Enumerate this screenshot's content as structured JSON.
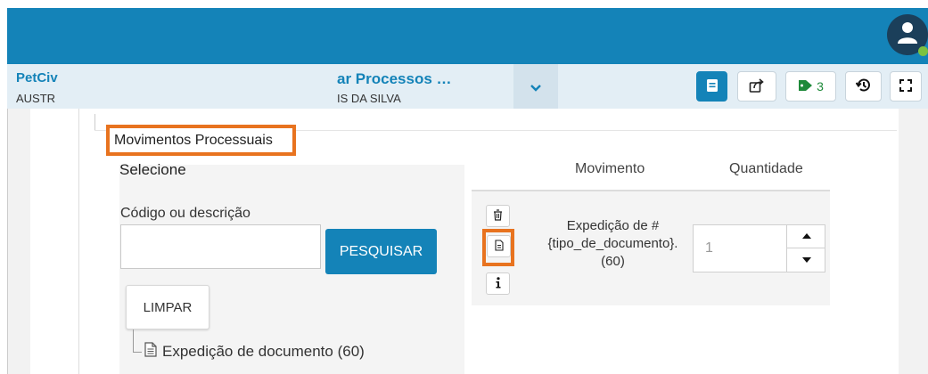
{
  "header": {
    "left_title": "PetCiv",
    "left_subtitle": "AUSTR",
    "center_title": "ar Processos …",
    "center_subtitle": "IS DA SILVA"
  },
  "toolbar": {
    "tags_count": "3"
  },
  "section": {
    "legend": "Movimentos Processuais"
  },
  "select_panel": {
    "title": "Selecione",
    "search_label": "Código ou descrição",
    "search_value": "",
    "search_button": "PESQUISAR",
    "clear_button": "LIMPAR",
    "tree_item": "Expedição de documento (60)"
  },
  "movements_table": {
    "columns": [
      "Movimento",
      "Quantidade"
    ],
    "rows": [
      {
        "movimento": "Expedição de #{tipo_de_documento}. (60)",
        "quantidade": "1"
      }
    ]
  },
  "colors": {
    "primary": "#1483b8",
    "highlight": "#e8731f",
    "tag_green": "#1f8a3a",
    "online": "#7cc241"
  },
  "icons": [
    "user-icon",
    "chevron-down-icon",
    "notebook-icon",
    "share-icon",
    "tag-icon",
    "history-icon",
    "fullscreen-icon",
    "trash-icon",
    "document-icon",
    "info-icon",
    "file-icon",
    "caret-up-icon",
    "caret-down-icon"
  ]
}
